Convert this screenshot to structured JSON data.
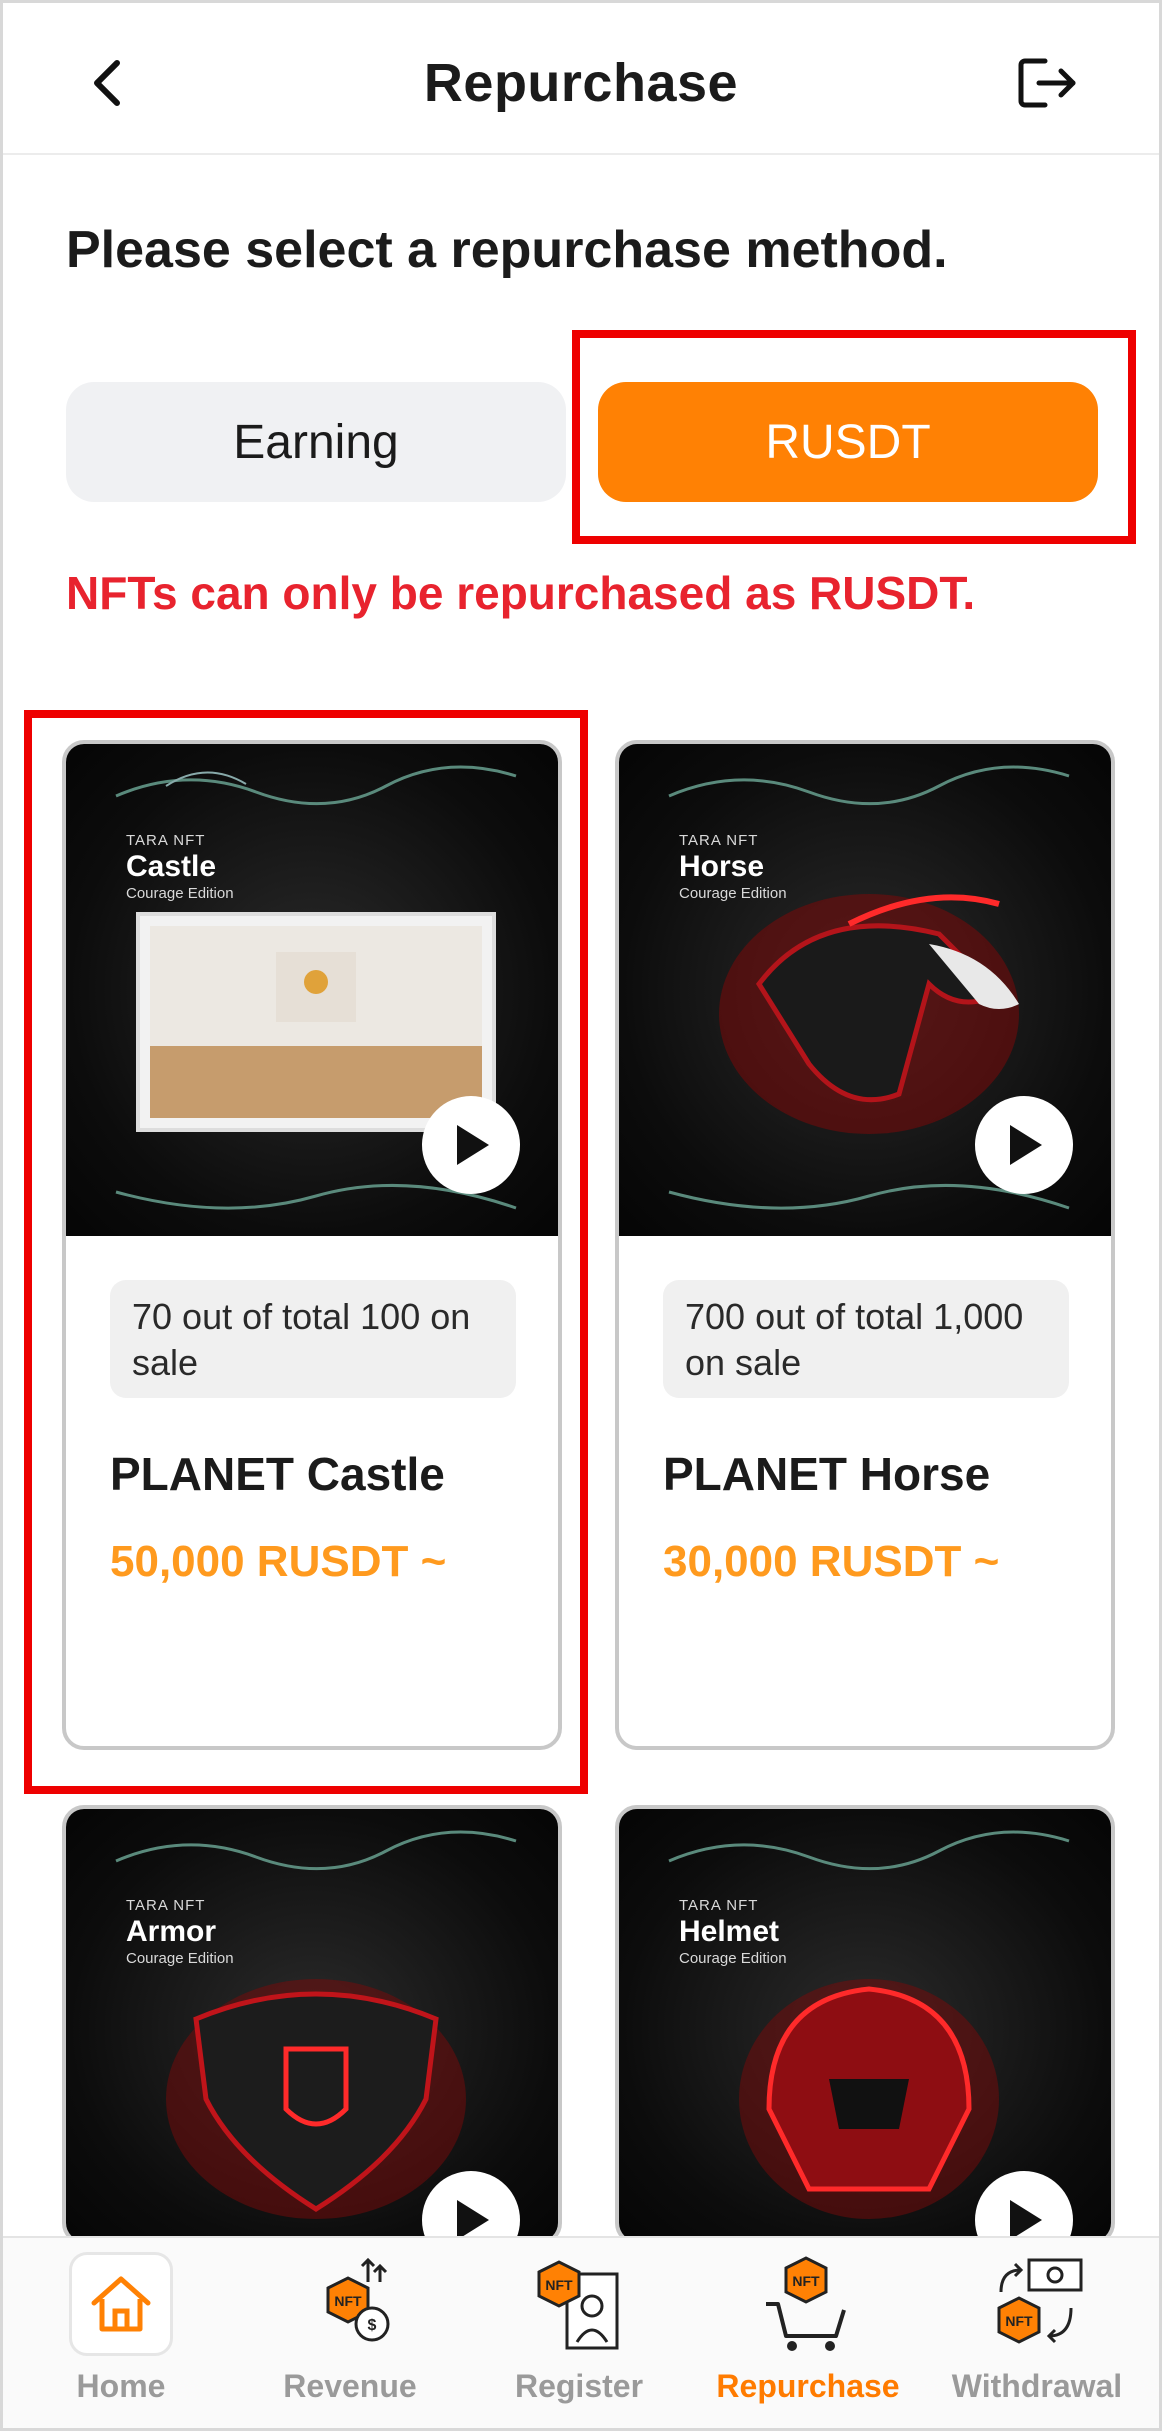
{
  "header": {
    "title": "Repurchase"
  },
  "prompt": "Please select a repurchase method.",
  "methods": [
    {
      "label": "Earning",
      "selected": false
    },
    {
      "label": "RUSDT",
      "selected": true
    }
  ],
  "notice": "NFTs can only be repurchased as RUSDT.",
  "nfts": [
    {
      "brand": "TARA NFT",
      "art_title": "Castle",
      "edition": "Courage Edition",
      "stock": "70 out of total 100 on sale",
      "name": "PLANET Castle",
      "price": "50,000 RUSDT ~"
    },
    {
      "brand": "TARA NFT",
      "art_title": "Horse",
      "edition": "Courage Edition",
      "stock": "700 out of total 1,000 on sale",
      "name": "PLANET Horse",
      "price": "30,000 RUSDT ~"
    },
    {
      "brand": "TARA NFT",
      "art_title": "Armor",
      "edition": "Courage Edition"
    },
    {
      "brand": "TARA NFT",
      "art_title": "Helmet",
      "edition": "Courage Edition"
    }
  ],
  "nav": [
    {
      "label": "Home",
      "icon": "home-icon",
      "active": false
    },
    {
      "label": "Revenue",
      "icon": "nft-revenue-icon",
      "active": false
    },
    {
      "label": "Register",
      "icon": "nft-register-icon",
      "active": false
    },
    {
      "label": "Repurchase",
      "icon": "nft-cart-icon",
      "active": true
    },
    {
      "label": "Withdrawal",
      "icon": "nft-withdrawal-icon",
      "active": false
    }
  ],
  "colors": {
    "accent": "#ff8104",
    "price": "#ff9a1e",
    "notice": "#e8232e",
    "highlight": "#ee0000"
  }
}
